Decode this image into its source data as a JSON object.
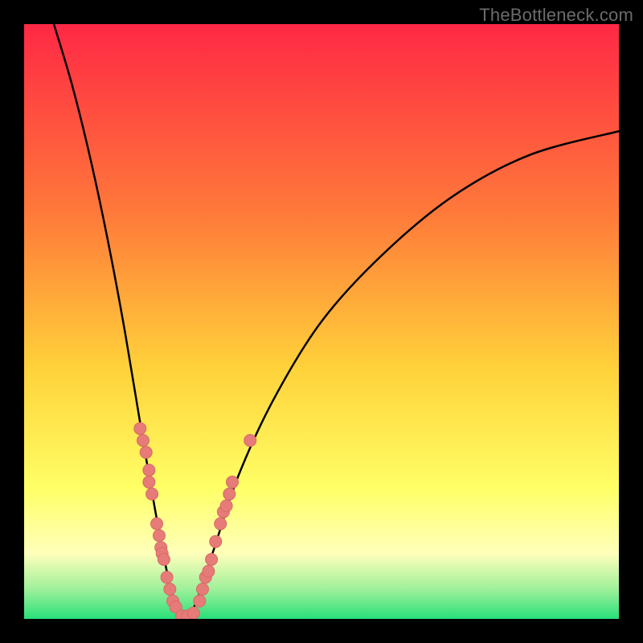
{
  "watermark": "TheBottleneck.com",
  "colors": {
    "black": "#000000",
    "curve": "#000000",
    "dot_fill": "#e77b78",
    "dot_stroke": "#d66a67",
    "grad_top": "#ff2845",
    "grad_mid1": "#ff7a3a",
    "grad_mid2": "#ffd23a",
    "grad_mid3": "#ffff66",
    "grad_pale": "#ffffbb",
    "grad_green1": "#9ff09a",
    "grad_green2": "#28e07a"
  },
  "chart_data": {
    "type": "line",
    "title": "",
    "xlabel": "",
    "ylabel": "",
    "xlim": [
      0,
      100
    ],
    "ylim": [
      0,
      100
    ],
    "notes": "V-shaped bottleneck curve over a vertical red→orange→yellow→green gradient. Minimum of curve sits near x≈27, y≈0. Left branch starts near top-left corner (x≈5, y≈100) and drops steeply. Right branch rises with diminishing slope toward top-right (x≈100, y≈82). Salmon dots cluster along both branches in the lower y≈0–32 region.",
    "series": [
      {
        "name": "bottleneck-curve",
        "points": [
          {
            "x": 5,
            "y": 100
          },
          {
            "x": 8,
            "y": 90
          },
          {
            "x": 11,
            "y": 78
          },
          {
            "x": 14,
            "y": 64
          },
          {
            "x": 17,
            "y": 48
          },
          {
            "x": 20,
            "y": 30
          },
          {
            "x": 23,
            "y": 13
          },
          {
            "x": 25,
            "y": 4
          },
          {
            "x": 27,
            "y": 0
          },
          {
            "x": 29,
            "y": 3
          },
          {
            "x": 32,
            "y": 12
          },
          {
            "x": 36,
            "y": 24
          },
          {
            "x": 42,
            "y": 37
          },
          {
            "x": 50,
            "y": 50
          },
          {
            "x": 60,
            "y": 61
          },
          {
            "x": 72,
            "y": 71
          },
          {
            "x": 85,
            "y": 78
          },
          {
            "x": 100,
            "y": 82
          }
        ]
      }
    ],
    "scatter": [
      {
        "x": 19.5,
        "y": 32
      },
      {
        "x": 20.0,
        "y": 30
      },
      {
        "x": 20.5,
        "y": 28
      },
      {
        "x": 21.0,
        "y": 25
      },
      {
        "x": 21.0,
        "y": 23
      },
      {
        "x": 21.5,
        "y": 21
      },
      {
        "x": 22.3,
        "y": 16
      },
      {
        "x": 22.7,
        "y": 14
      },
      {
        "x": 23.0,
        "y": 12
      },
      {
        "x": 23.2,
        "y": 11
      },
      {
        "x": 23.5,
        "y": 10
      },
      {
        "x": 24.0,
        "y": 7
      },
      {
        "x": 24.5,
        "y": 5
      },
      {
        "x": 25.0,
        "y": 3
      },
      {
        "x": 25.5,
        "y": 2
      },
      {
        "x": 26.5,
        "y": 0.5
      },
      {
        "x": 27.5,
        "y": 0.5
      },
      {
        "x": 28.5,
        "y": 1
      },
      {
        "x": 29.5,
        "y": 3
      },
      {
        "x": 30.0,
        "y": 5
      },
      {
        "x": 30.5,
        "y": 7
      },
      {
        "x": 31.0,
        "y": 8
      },
      {
        "x": 31.5,
        "y": 10
      },
      {
        "x": 32.2,
        "y": 13
      },
      {
        "x": 33.0,
        "y": 16
      },
      {
        "x": 33.5,
        "y": 18
      },
      {
        "x": 34.0,
        "y": 19
      },
      {
        "x": 34.5,
        "y": 21
      },
      {
        "x": 35.0,
        "y": 23
      },
      {
        "x": 38.0,
        "y": 30
      }
    ]
  }
}
